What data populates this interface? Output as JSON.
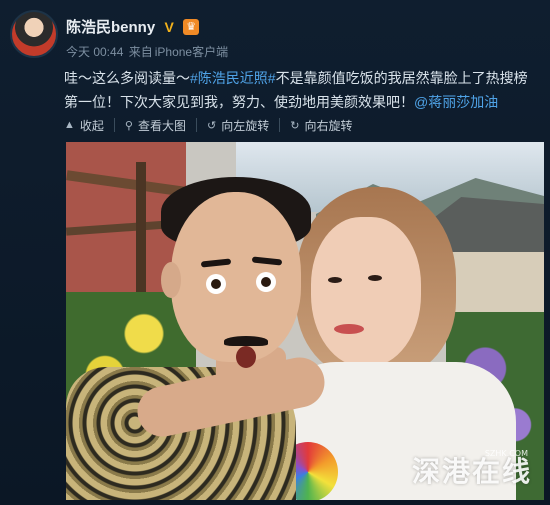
{
  "post": {
    "username": "陈浩民benny",
    "verified_symbol": "V",
    "badge_symbol": "♛",
    "time": "今天 00:44",
    "source_prefix": "来自",
    "source": "iPhone客户端",
    "text_part1": "哇～这么多阅读量～",
    "hashtag": "#陈浩民近照#",
    "text_part2": "不是靠颜值吃饭的我居然靠脸上了热搜榜第一位！下次大家见到我，努力、使劲地用美颜效果吧！",
    "mention": "@蒋丽莎加油"
  },
  "toolbar": {
    "collapse": "收起",
    "view_large": "查看大图",
    "rotate_left": "向左旋转",
    "rotate_right": "向右旋转"
  },
  "icons": {
    "collapse": "caret-up-icon",
    "view_large": "magnifier-icon",
    "rotate_left": "rotate-left-icon",
    "rotate_right": "rotate-right-icon"
  },
  "photo": {
    "watermark": "深港在线",
    "watermark_url": "SZHK.COM"
  },
  "colors": {
    "background": "#0d1b2a",
    "link": "#4fa3e7",
    "verified": "#f3b21b"
  }
}
